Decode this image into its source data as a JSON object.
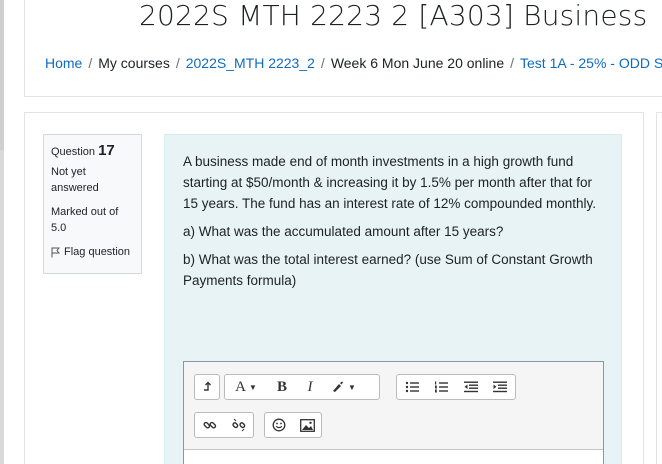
{
  "page": {
    "title": "2022S MTH 2223 2 [A303] Business"
  },
  "breadcrumb": {
    "items": [
      "Home",
      "My courses",
      "2022S_MTH 2223_2",
      "Week 6 Mon June 20 online",
      "Test 1A - 25% - ODD S"
    ],
    "separator": "/"
  },
  "question": {
    "label": "Question",
    "number": "17",
    "state": "Not yet answered",
    "grade": "Marked out of 5.0",
    "flag_label": "Flag question",
    "paragraphs": [
      "A business made end of month investments in a high growth fund starting at $50/month & increasing it by 1.5% per month after that for 15 years. The fund has an interest rate of 12% compounded monthly.",
      "a) What was the accumulated amount after 15 years?",
      "b) What was the total interest earned? (use Sum of Constant Growth Payments formula)"
    ]
  },
  "editor": {
    "toolbar_row1": [
      "collapse-icon",
      "font-size-icon",
      "bold-icon",
      "italic-icon",
      "text-color-icon",
      "unordered-list-icon",
      "ordered-list-icon",
      "outdent-icon",
      "indent-icon"
    ],
    "toolbar_row2": [
      "link-icon",
      "unlink-icon",
      "emoji-icon",
      "image-icon"
    ],
    "font_button_label": "A",
    "bold_label": "B",
    "italic_label": "I"
  },
  "colors": {
    "link": "#0f6cbf",
    "formulation_bg": "#e7f3f5",
    "info_bg": "#f8f9fa"
  }
}
